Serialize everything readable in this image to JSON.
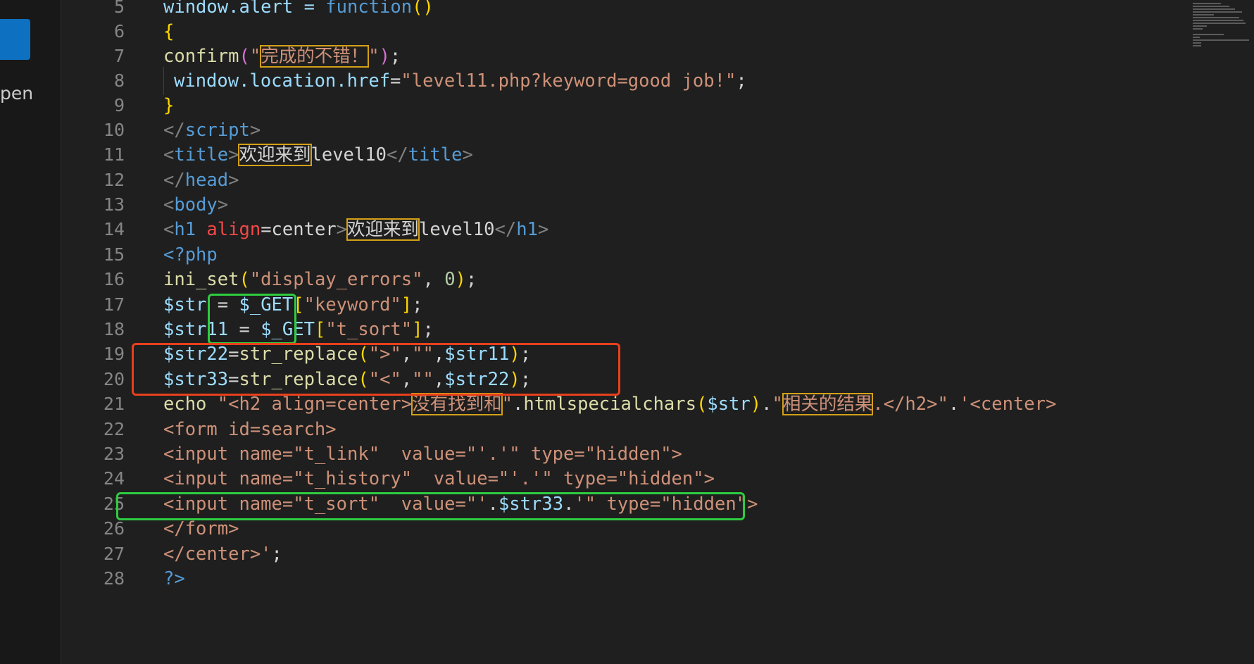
{
  "sidebar": {
    "partial_label": "pen"
  },
  "editor": {
    "lines": [
      {
        "n": "5"
      },
      {
        "n": "6"
      },
      {
        "n": "7"
      },
      {
        "n": "8"
      },
      {
        "n": "9"
      },
      {
        "n": "10"
      },
      {
        "n": "11"
      },
      {
        "n": "12"
      },
      {
        "n": "13"
      },
      {
        "n": "14"
      },
      {
        "n": "15"
      },
      {
        "n": "16"
      },
      {
        "n": "17"
      },
      {
        "n": "18"
      },
      {
        "n": "19"
      },
      {
        "n": "20"
      },
      {
        "n": "21"
      },
      {
        "n": "22"
      },
      {
        "n": "23"
      },
      {
        "n": "24"
      },
      {
        "n": "25"
      },
      {
        "n": "26"
      },
      {
        "n": "27"
      },
      {
        "n": "28"
      }
    ],
    "t": {
      "l5a": "window.alert = ",
      "l5b": "function",
      "l5c": "()",
      "l6": "{",
      "l7a": "confirm",
      "l7b": "(",
      "l7c": "\"",
      "l7d": "完成的不错！",
      "l7e": "\"",
      "l7f": ")",
      "l7g": ";",
      "l8a": "window.location.href",
      "l8b": "=",
      "l8c": "\"level11.php?keyword=good job!\"",
      "l8d": ";",
      "l9": "}",
      "l10a": "</",
      "l10b": "script",
      "l10c": ">",
      "l11a": "<",
      "l11b": "title",
      "l11c": ">",
      "l11d": "欢迎来到",
      "l11e": "level10",
      "l11f": "</",
      "l11g": "title",
      "l11h": ">",
      "l12a": "</",
      "l12b": "head",
      "l12c": ">",
      "l13a": "<",
      "l13b": "body",
      "l13c": ">",
      "l14a": "<",
      "l14b": "h1",
      "l14c": " align",
      "l14d": "=center",
      "l14e": ">",
      "l14f": "欢迎来到",
      "l14g": "level10",
      "l14h": "</",
      "l14i": "h1",
      "l14j": ">",
      "l15": "<?php",
      "l16a": "ini_set",
      "l16b": "(",
      "l16c": "\"display_errors\"",
      "l16d": ", ",
      "l16e": "0",
      "l16f": ")",
      "l16g": ";",
      "l17a": "$str",
      "l17b": " = ",
      "l17c": "$_GET",
      "l17d": "[",
      "l17e": "\"keyword\"",
      "l17f": "]",
      "l17g": ";",
      "l18a": "$str11",
      "l18b": " = ",
      "l18c": "$_GET",
      "l18d": "[",
      "l18e": "\"t_sort\"",
      "l18f": "]",
      "l18g": ";",
      "l19a": "$str22",
      "l19b": "=",
      "l19c": "str_replace",
      "l19d": "(",
      "l19e": "\">\"",
      "l19f": ",",
      "l19g": "\"\"",
      "l19h": ",",
      "l19i": "$str11",
      "l19j": ")",
      "l19k": ";",
      "l20a": "$str33",
      "l20b": "=",
      "l20c": "str_replace",
      "l20d": "(",
      "l20e": "\"<\"",
      "l20f": ",",
      "l20g": "\"\"",
      "l20h": ",",
      "l20i": "$str22",
      "l20j": ")",
      "l20k": ";",
      "l21a": "echo ",
      "l21b": "\"<h2 align=center>",
      "l21c": "没有找到和",
      "l21d": "\"",
      "l21e": ".",
      "l21f": "htmlspecialchars",
      "l21g": "(",
      "l21h": "$str",
      "l21i": ")",
      "l21j": ".",
      "l21k": "\"",
      "l21l": "相关的结果",
      "l21m": ".</h2>\"",
      "l21n": ".",
      "l21o": "'<center>",
      "l22": "<form id=search>",
      "l23": "<input name=\"t_link\"  value=\"'.'\" type=\"hidden\">",
      "l24": "<input name=\"t_history\"  value=\"'.'\" type=\"hidden\">",
      "l25a": "<input name=\"t_sort\"  value=\"'",
      "l25b": ".",
      "l25c": "$str33",
      "l25d": ".",
      "l25e": "'\" type=\"hidden\">",
      "l26": "</form>",
      "l27a": "</center>'",
      "l27b": ";",
      "l28": "?>"
    }
  },
  "colors": {
    "background": "#1f1f1f",
    "annotation_green": "#2ecc40",
    "annotation_red": "#e8401c",
    "highlight_yellow": "#d4a017"
  }
}
